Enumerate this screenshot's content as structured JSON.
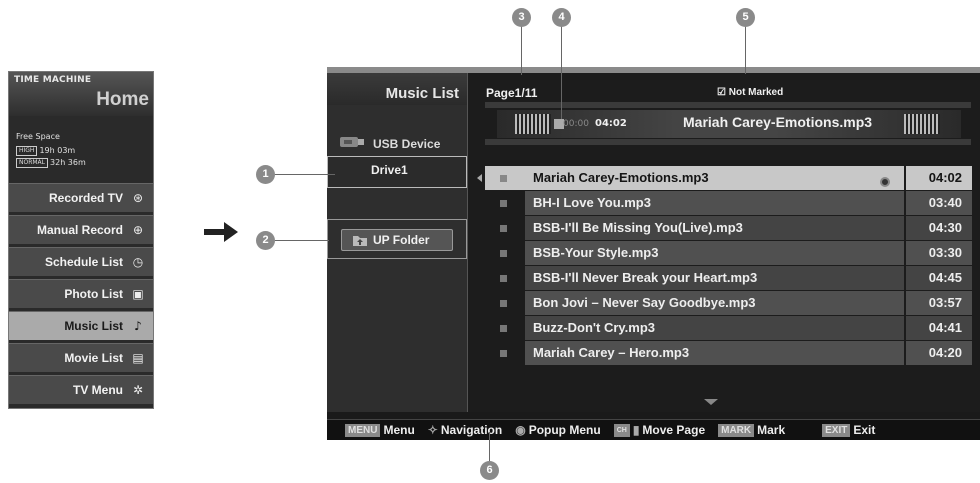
{
  "colors": {
    "screen_bg": "#1a1a1a",
    "row_selected": "#c8c8c8",
    "callout": "#8a8a8a"
  },
  "time_machine": {
    "brand": "TIME MACHINE",
    "title": "Home",
    "free_space_label": "Free Space",
    "high_badge": "HIGH",
    "high_time": "19h 03m",
    "normal_badge": "NORMAL",
    "normal_time": "32h 36m",
    "items": [
      {
        "label": "Recorded TV",
        "icon": "recorded-tv-icon",
        "glyph": "⊛"
      },
      {
        "label": "Manual Record",
        "icon": "manual-record-icon",
        "glyph": "⊕"
      },
      {
        "label": "Schedule List",
        "icon": "schedule-clock-icon",
        "glyph": "◷"
      },
      {
        "label": "Photo List",
        "icon": "photo-icon",
        "glyph": "▣"
      },
      {
        "label": "Music List",
        "icon": "music-note-icon",
        "glyph": "♪"
      },
      {
        "label": "Movie List",
        "icon": "movie-icon",
        "glyph": "▤"
      },
      {
        "label": "TV Menu",
        "icon": "gears-icon",
        "glyph": "✲"
      }
    ],
    "selected": "Music List"
  },
  "callouts": [
    "1",
    "2",
    "3",
    "4",
    "5",
    "6"
  ],
  "music": {
    "title": "Music List",
    "device": "USB Device",
    "drive": "Drive1",
    "up_folder": "UP Folder",
    "page": "Page1/11",
    "marked": "☑ Not Marked",
    "now_playing": {
      "elapsed": "00:00",
      "duration": "04:02",
      "title": "Mariah Carey-Emotions.mp3"
    },
    "songs": [
      {
        "name": "Mariah Carey-Emotions.mp3",
        "time": "04:02"
      },
      {
        "name": "BH-I Love You.mp3",
        "time": "03:40"
      },
      {
        "name": "BSB-I'll Be Missing You(Live).mp3",
        "time": "04:30"
      },
      {
        "name": "BSB-Your Style.mp3",
        "time": "03:30"
      },
      {
        "name": "BSB-I'll Never Break your Heart.mp3",
        "time": "04:45"
      },
      {
        "name": "Bon Jovi – Never Say Goodbye.mp3",
        "time": "03:57"
      },
      {
        "name": "Buzz-Don't Cry.mp3",
        "time": "04:41"
      },
      {
        "name": "Mariah Carey – Hero.mp3",
        "time": "04:20"
      }
    ],
    "footer": {
      "menu_key": "MENU",
      "menu": "Menu",
      "navigation": "Navigation",
      "popup": "Popup Menu",
      "page_key": "CH",
      "move_page": "Move Page",
      "mark_key": "MARK",
      "mark": "Mark",
      "exit_key": "EXIT",
      "exit": "Exit"
    }
  }
}
